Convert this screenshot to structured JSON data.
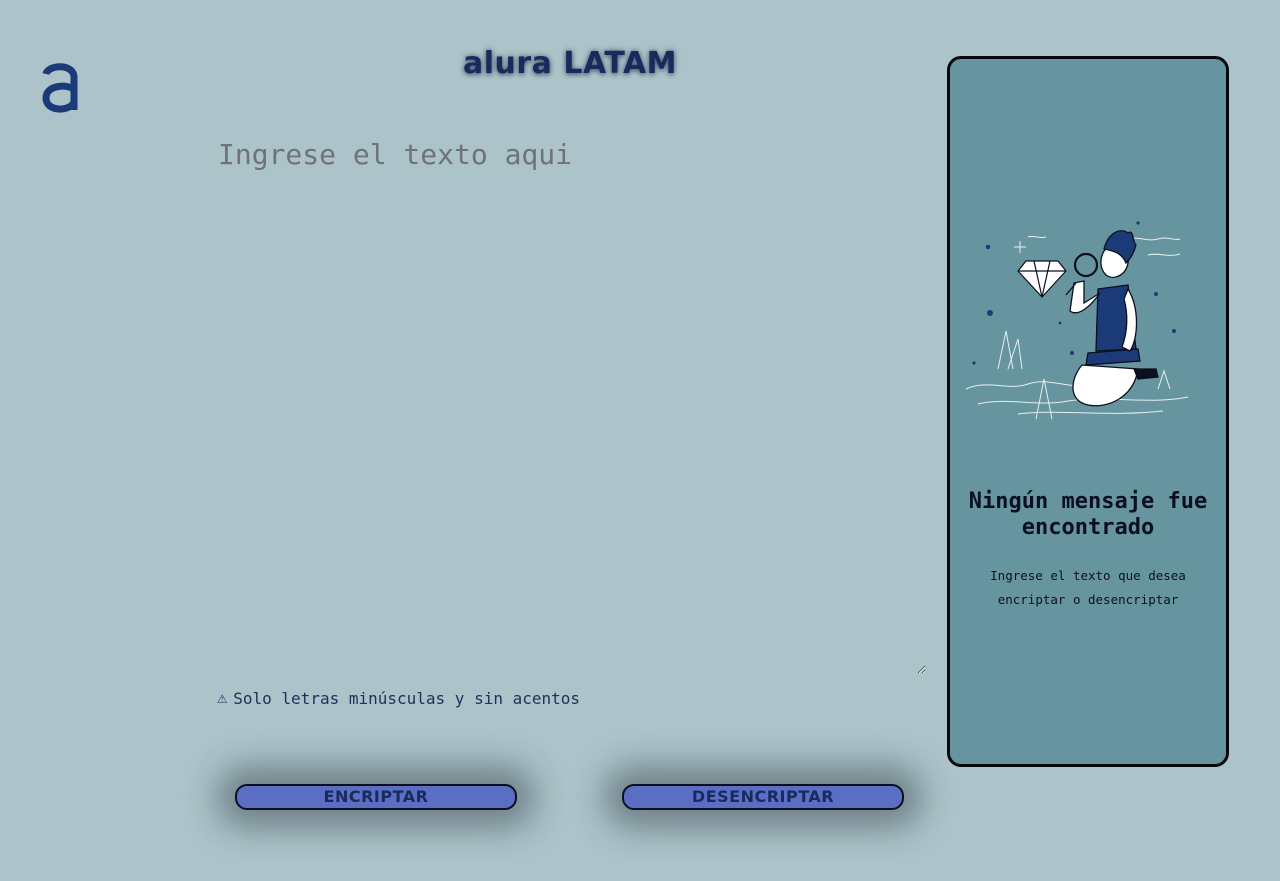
{
  "header": {
    "logo_icon": "alura-a-logo-icon",
    "title": "alura LATAM"
  },
  "editor": {
    "placeholder": "Ingrese el texto aqui",
    "value": ""
  },
  "warning": {
    "icon": "warning-triangle-icon",
    "glyph": "⚠",
    "text": "Solo letras minúsculas y sin acentos"
  },
  "actions": {
    "encrypt_label": "ENCRIPTAR",
    "decrypt_label": "DESENCRIPTAR"
  },
  "result_panel": {
    "illustration": "person-with-magnifier-illustration",
    "title": "Ningún mensaje fue encontrado",
    "message": "Ingrese el texto que desea encriptar o desencriptar"
  },
  "colors": {
    "page_background": "#abc3c9",
    "brand_navy": "#1b2a5c",
    "button_fill": "#5a6ec4",
    "panel_background": "#6695a0"
  }
}
